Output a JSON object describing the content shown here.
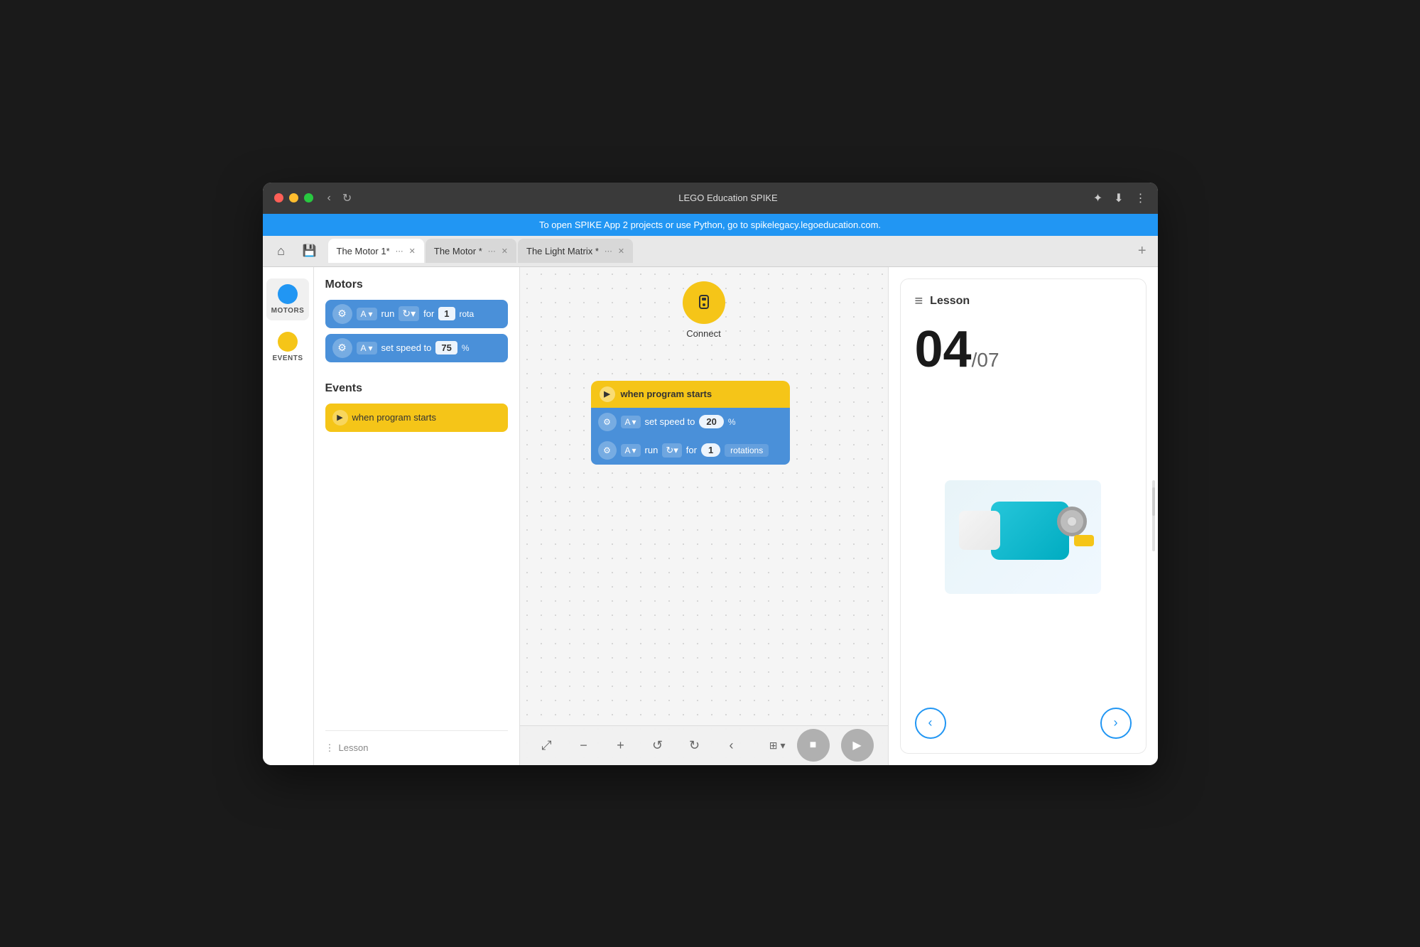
{
  "window": {
    "title": "LEGO Education SPIKE",
    "banner": "To open SPIKE App 2 projects or use Python, go to spikelegacy.legoeducation.com."
  },
  "tabs": [
    {
      "label": "The Motor 1*",
      "active": true
    },
    {
      "label": "The Motor *",
      "active": false
    },
    {
      "label": "The Light Matrix *",
      "active": false
    }
  ],
  "sidebar": {
    "items": [
      {
        "label": "MOTORS",
        "color": "#2196f3",
        "active": true
      },
      {
        "label": "EVENTS",
        "color": "#f5c518",
        "active": false
      }
    ]
  },
  "palette": {
    "motors_title": "Motors",
    "events_title": "Events",
    "block_run": "run",
    "block_run_for": "for",
    "block_run_rotations": "rotations",
    "block_set_speed": "set speed to",
    "block_speed_value": "75",
    "block_speed_unit": "%",
    "block_port_a": "A",
    "block_port_a2": "A",
    "block_when_program_starts": "when program starts",
    "block_run_value": "1",
    "lesson_bottom": "Lesson"
  },
  "canvas": {
    "connect_label": "Connect",
    "when_program_starts": "when program starts",
    "set_speed_label": "set speed to",
    "speed_value": "20",
    "speed_unit": "%",
    "run_label": "run",
    "run_for_label": "for",
    "run_value": "1",
    "rotations_label": "rotations",
    "port_a": "A",
    "port_a2": "A"
  },
  "lesson": {
    "title": "Lesson",
    "number": "04",
    "total": "/07"
  },
  "toolbar": {
    "compress_icon": "⤢",
    "zoom_out_icon": "−",
    "zoom_in_icon": "+",
    "undo_icon": "↺",
    "redo_icon": "↻",
    "back_icon": "‹",
    "stop_icon": "■",
    "play_icon": "▶"
  }
}
